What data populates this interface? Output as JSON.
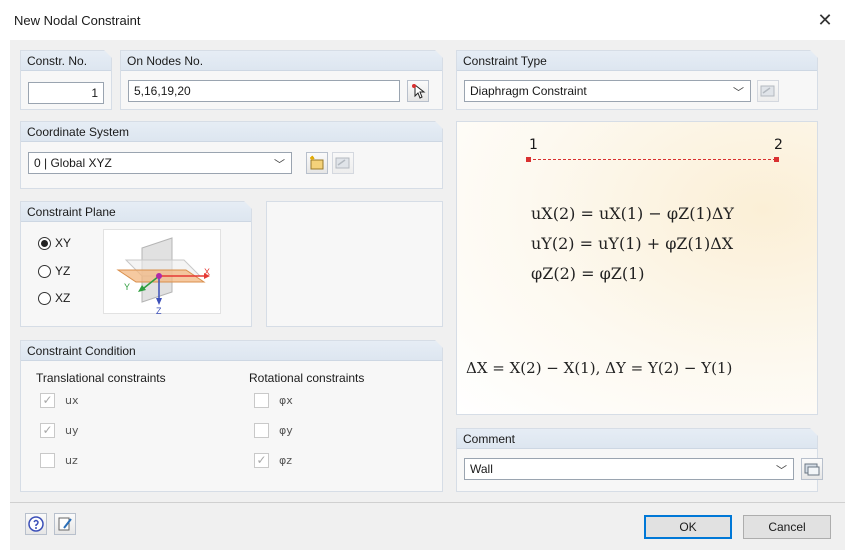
{
  "window": {
    "title": "New Nodal Constraint",
    "close_glyph": "✕"
  },
  "constr_no": {
    "header": "Constr. No.",
    "value": "1"
  },
  "nodes": {
    "header": "On Nodes No.",
    "value": "5,16,19,20"
  },
  "constraint_type": {
    "header": "Constraint Type",
    "value": "Diaphragm Constraint"
  },
  "coordinate_system": {
    "header": "Coordinate System",
    "value": "0 | Global XYZ"
  },
  "constraint_plane": {
    "header": "Constraint Plane",
    "options": [
      {
        "label": "XY",
        "selected": true
      },
      {
        "label": "YZ",
        "selected": false
      },
      {
        "label": "XZ",
        "selected": false
      }
    ],
    "axis_labels": {
      "x": "X",
      "y": "Y",
      "z": "Z"
    }
  },
  "constraint_condition": {
    "header": "Constraint Condition",
    "translational_title": "Translational constraints",
    "rotational_title": "Rotational constraints",
    "translational": [
      {
        "label": "ux",
        "checked": true
      },
      {
        "label": "uy",
        "checked": true
      },
      {
        "label": "uz",
        "checked": false
      }
    ],
    "rotational": [
      {
        "label": "φx",
        "checked": false
      },
      {
        "label": "φy",
        "checked": false
      },
      {
        "label": "φz",
        "checked": true
      }
    ]
  },
  "diagram": {
    "node1": "1",
    "node2": "2",
    "eq1": "uX(2) = uX(1) − φZ(1)ΔY",
    "eq2": "uY(2) = uY(1) + φZ(1)ΔX",
    "eq3": "φZ(2) = φZ(1)",
    "eq4": "ΔX = X(2) − X(1), ΔY = Y(2) − Y(1)"
  },
  "comment": {
    "header": "Comment",
    "value": "Wall"
  },
  "buttons": {
    "ok": "OK",
    "cancel": "Cancel"
  },
  "icons": {
    "pick_nodes": "pick-cursor-icon",
    "type_edit": "edit-library-icon",
    "cs_new": "new-coordinate-system-icon",
    "cs_edit": "edit-library-icon",
    "comment_library": "library-icon",
    "help": "help-icon",
    "edit": "edit-icon"
  },
  "colors": {
    "x_axis": "#e53935",
    "y_axis": "#2e9e3e",
    "z_axis": "#3b4fb8",
    "node_red": "#d93030"
  }
}
